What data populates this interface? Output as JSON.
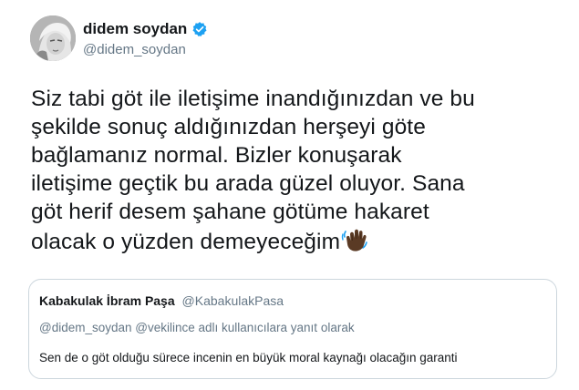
{
  "author": {
    "display_name": "didem soydan",
    "handle": "@didem_soydan",
    "avatar_icon": "profile-photo",
    "verified_icon": "verified-badge-icon",
    "verified_color": "#1da1f2"
  },
  "tweet": {
    "lines": [
      "Siz tabi göt ile iletişime  inandığınızdan ve bu",
      "şekilde sonuç aldığınızdan herşeyi göte",
      "bağlamanız normal. Bizler konuşarak",
      "iletişime geçtik bu arada güzel oluyor. Sana",
      "göt herif desem şahane götüme hakaret",
      "olacak o yüzden demeyeceğim"
    ],
    "emoji_icon": "waving-hand-icon"
  },
  "quoted_tweet": {
    "display_name": "Kabakulak İbram Paşa",
    "handle": "@KabakulakPasa",
    "reply_context": "@didem_soydan @vekilince adlı kullanıcılara yanıt olarak",
    "text": "Sen de o göt olduğu sürece incenin en büyük moral kaynağı olacağın garanti"
  },
  "colors": {
    "text_primary": "#14171a",
    "text_secondary": "#657786",
    "border": "#ccd6dd",
    "background": "#ffffff"
  }
}
